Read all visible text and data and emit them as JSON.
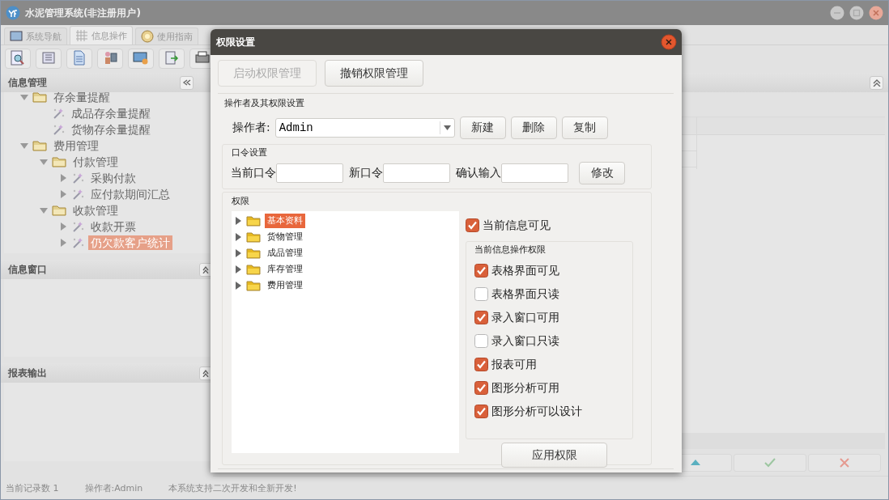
{
  "window": {
    "title": "水泥管理系统(非注册用户)"
  },
  "tabs": [
    {
      "label": "系统导航",
      "selected": false
    },
    {
      "label": "信息操作",
      "selected": true
    },
    {
      "label": "使用指南",
      "selected": false
    }
  ],
  "sidebar": {
    "panels": [
      {
        "title": "信息管理",
        "tree": [
          {
            "label": "存余量提醒",
            "kind": "folder",
            "expanded": true,
            "selected": false,
            "children": [
              {
                "label": "成品存余量提醒",
                "kind": "item",
                "selected": false
              },
              {
                "label": "货物存余量提醒",
                "kind": "item",
                "selected": false
              }
            ]
          },
          {
            "label": "费用管理",
            "kind": "folder",
            "expanded": true,
            "selected": false,
            "children": [
              {
                "label": "付款管理",
                "kind": "folder",
                "expanded": true,
                "selected": false,
                "children": [
                  {
                    "label": "采购付款",
                    "kind": "item",
                    "expanded": false,
                    "selected": false
                  },
                  {
                    "label": "应付款期间汇总",
                    "kind": "item",
                    "expanded": false,
                    "selected": false
                  }
                ]
              },
              {
                "label": "收款管理",
                "kind": "folder",
                "expanded": true,
                "selected": false,
                "children": [
                  {
                    "label": "收款开票",
                    "kind": "item",
                    "expanded": false,
                    "selected": false
                  },
                  {
                    "label": "仍欠款客户统计",
                    "kind": "item",
                    "expanded": false,
                    "selected": true
                  }
                ]
              }
            ]
          }
        ]
      },
      {
        "title": "信息窗口"
      },
      {
        "title": "报表输出"
      }
    ]
  },
  "status_bar": [
    "当前记录数 1",
    "操作者:Admin",
    "本系统支持二次开发和全新开发!"
  ],
  "dialog": {
    "title": "权限设置",
    "mode_buttons": [
      {
        "label": "启动权限管理",
        "disabled": true
      },
      {
        "label": "撤销权限管理",
        "disabled": false
      }
    ],
    "operator_group": {
      "title": "操作者及其权限设置",
      "label": "操作者:",
      "value": "Admin",
      "buttons": [
        "新建",
        "删除",
        "复制"
      ]
    },
    "password_group": {
      "title": "口令设置",
      "fields": [
        {
          "label": "当前口令"
        },
        {
          "label": "新口令"
        },
        {
          "label": "确认输入"
        }
      ],
      "button": "修改"
    },
    "permission_group": {
      "title": "权限",
      "tree": [
        {
          "label": "基本资料",
          "expanded": false,
          "selected": true
        },
        {
          "label": "货物管理",
          "expanded": false,
          "selected": false
        },
        {
          "label": "成品管理",
          "expanded": false,
          "selected": false
        },
        {
          "label": "库存管理",
          "expanded": false,
          "selected": false
        },
        {
          "label": "费用管理",
          "expanded": false,
          "selected": false
        }
      ],
      "visible_checkbox": {
        "label": "当前信息可见",
        "checked": true
      },
      "operations": {
        "title": "当前信息操作权限",
        "items": [
          {
            "label": "表格界面可见",
            "checked": true
          },
          {
            "label": "表格界面只读",
            "checked": false
          },
          {
            "label": "录入窗口可用",
            "checked": true
          },
          {
            "label": "录入窗口只读",
            "checked": false
          },
          {
            "label": "报表可用",
            "checked": true
          },
          {
            "label": "图形分析可用",
            "checked": true
          },
          {
            "label": "图形分析可以设计",
            "checked": true
          }
        ]
      },
      "apply_button": "应用权限"
    }
  }
}
